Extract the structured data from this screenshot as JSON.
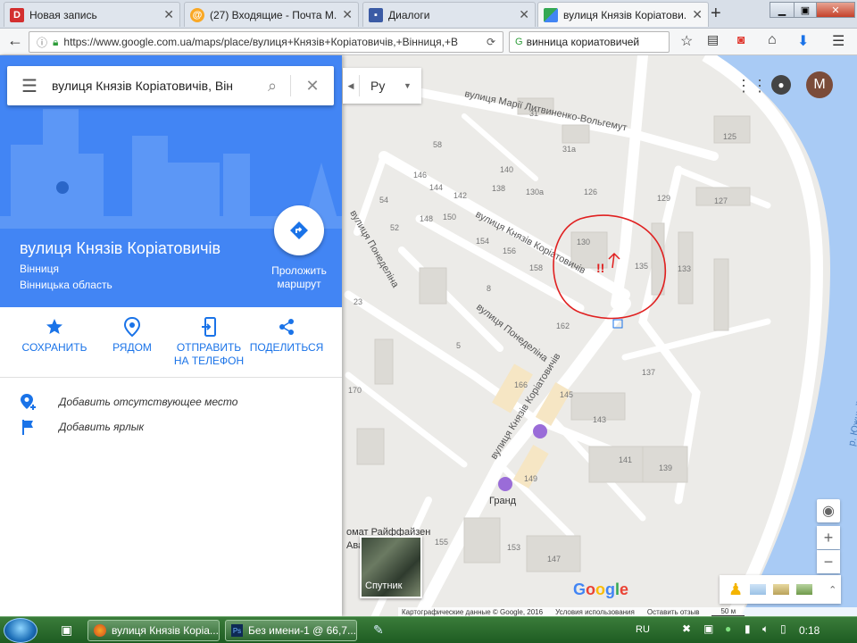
{
  "browser": {
    "tabs": [
      {
        "title": "Новая запись",
        "favicon": "D",
        "favicon_color": "#d32f2f"
      },
      {
        "title": "(27) Входящие - Почта М...",
        "favicon": "@",
        "favicon_color": "#f9a825"
      },
      {
        "title": "Диалоги",
        "favicon": "chat",
        "favicon_color": "#3b5ba5"
      },
      {
        "title": "вулиця Князів Коріатови...",
        "favicon": "maps",
        "favicon_color": "#34a853"
      }
    ],
    "url": "https://www.google.com.ua/maps/place/вулиця+Князів+Коріатовичів,+Вінниця,+В",
    "search_query": "винница кориатовичей"
  },
  "sidebar": {
    "search_value": "вулиця Князів Коріатовичів, Він",
    "place_title": "вулиця Князів Коріатовичів",
    "city": "Вінниця",
    "region": "Вінницька область",
    "directions_label": "Проложить маршрут",
    "actions": [
      {
        "label": "СОХРАНИТЬ",
        "icon": "star-icon"
      },
      {
        "label": "РЯДОМ",
        "icon": "nearby-icon"
      },
      {
        "label": "ОТПРАВИТЬ НА ТЕЛЕФОН",
        "icon": "send-to-phone-icon"
      },
      {
        "label": "ПОДЕЛИТЬСЯ",
        "icon": "share-icon"
      }
    ],
    "links": [
      {
        "label": "Добавить отсутствующее место",
        "icon": "add-place-icon"
      },
      {
        "label": "Добавить ярлык",
        "icon": "flag-icon"
      }
    ]
  },
  "map": {
    "language": "Ру",
    "account_initial": "М",
    "streets": [
      "вулиця Марії Литвиненко-Вольгемут",
      "вулиця Князів Коріатовичів",
      "вулиця Понеделіна",
      "вулиця Князів Коріатовичів",
      "вулиця Понеделіна",
      "р. Южный Буг"
    ],
    "house_numbers": [
      "58",
      "31",
      "140",
      "31а",
      "125",
      "146",
      "144",
      "142",
      "138",
      "130а",
      "126",
      "54",
      "148",
      "150",
      "154",
      "127",
      "129",
      "52",
      "130",
      "156",
      "135",
      "133",
      "158",
      "8",
      "23",
      "162",
      "5",
      "137",
      "166",
      "145",
      "170",
      "143",
      "141",
      "139",
      "149",
      "155",
      "153",
      "147"
    ],
    "poi": "Гранд",
    "poi_partial": "омат Райффайзен",
    "poi_partial2": "Ава",
    "annotation": "!!",
    "satellite_label": "Спутник",
    "logo": "Google",
    "attribution": [
      "Картографические данные © Google, 2016",
      "Условия использования",
      "Оставить отзыв",
      "50 м"
    ]
  },
  "taskbar": {
    "items": [
      "вулиця Князів Коріа...",
      "Без имени-1 @ 66,7..."
    ],
    "lang": "RU",
    "clock": "0:18"
  },
  "colors": {
    "accent": "#4285f4",
    "action_blue": "#1a73e8",
    "annotation_red": "#e02020"
  }
}
